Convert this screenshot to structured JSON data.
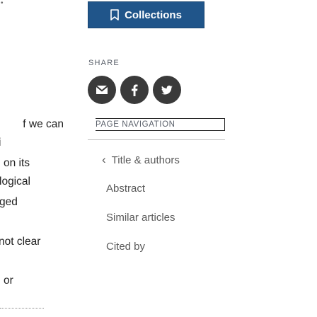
{
  "article": {
    "lines": [
      "f we can",
      "i",
      "on its",
      "logical",
      "ged",
      "not clear",
      "or"
    ]
  },
  "sidebar": {
    "collections_label": "Collections",
    "share_label": "SHARE",
    "share_icons": [
      "email-icon",
      "facebook-icon",
      "twitter-icon"
    ],
    "page_navigation_label": "PAGE NAVIGATION",
    "nav_items": [
      {
        "label": "Title & authors",
        "current": true
      },
      {
        "label": "Abstract"
      },
      {
        "label": "Similar articles"
      },
      {
        "label": "Cited by"
      }
    ]
  },
  "colors": {
    "collections_bg": "#20558a",
    "share_icon_bg": "#3a3a3a",
    "nav_text": "#5a5a5a"
  }
}
